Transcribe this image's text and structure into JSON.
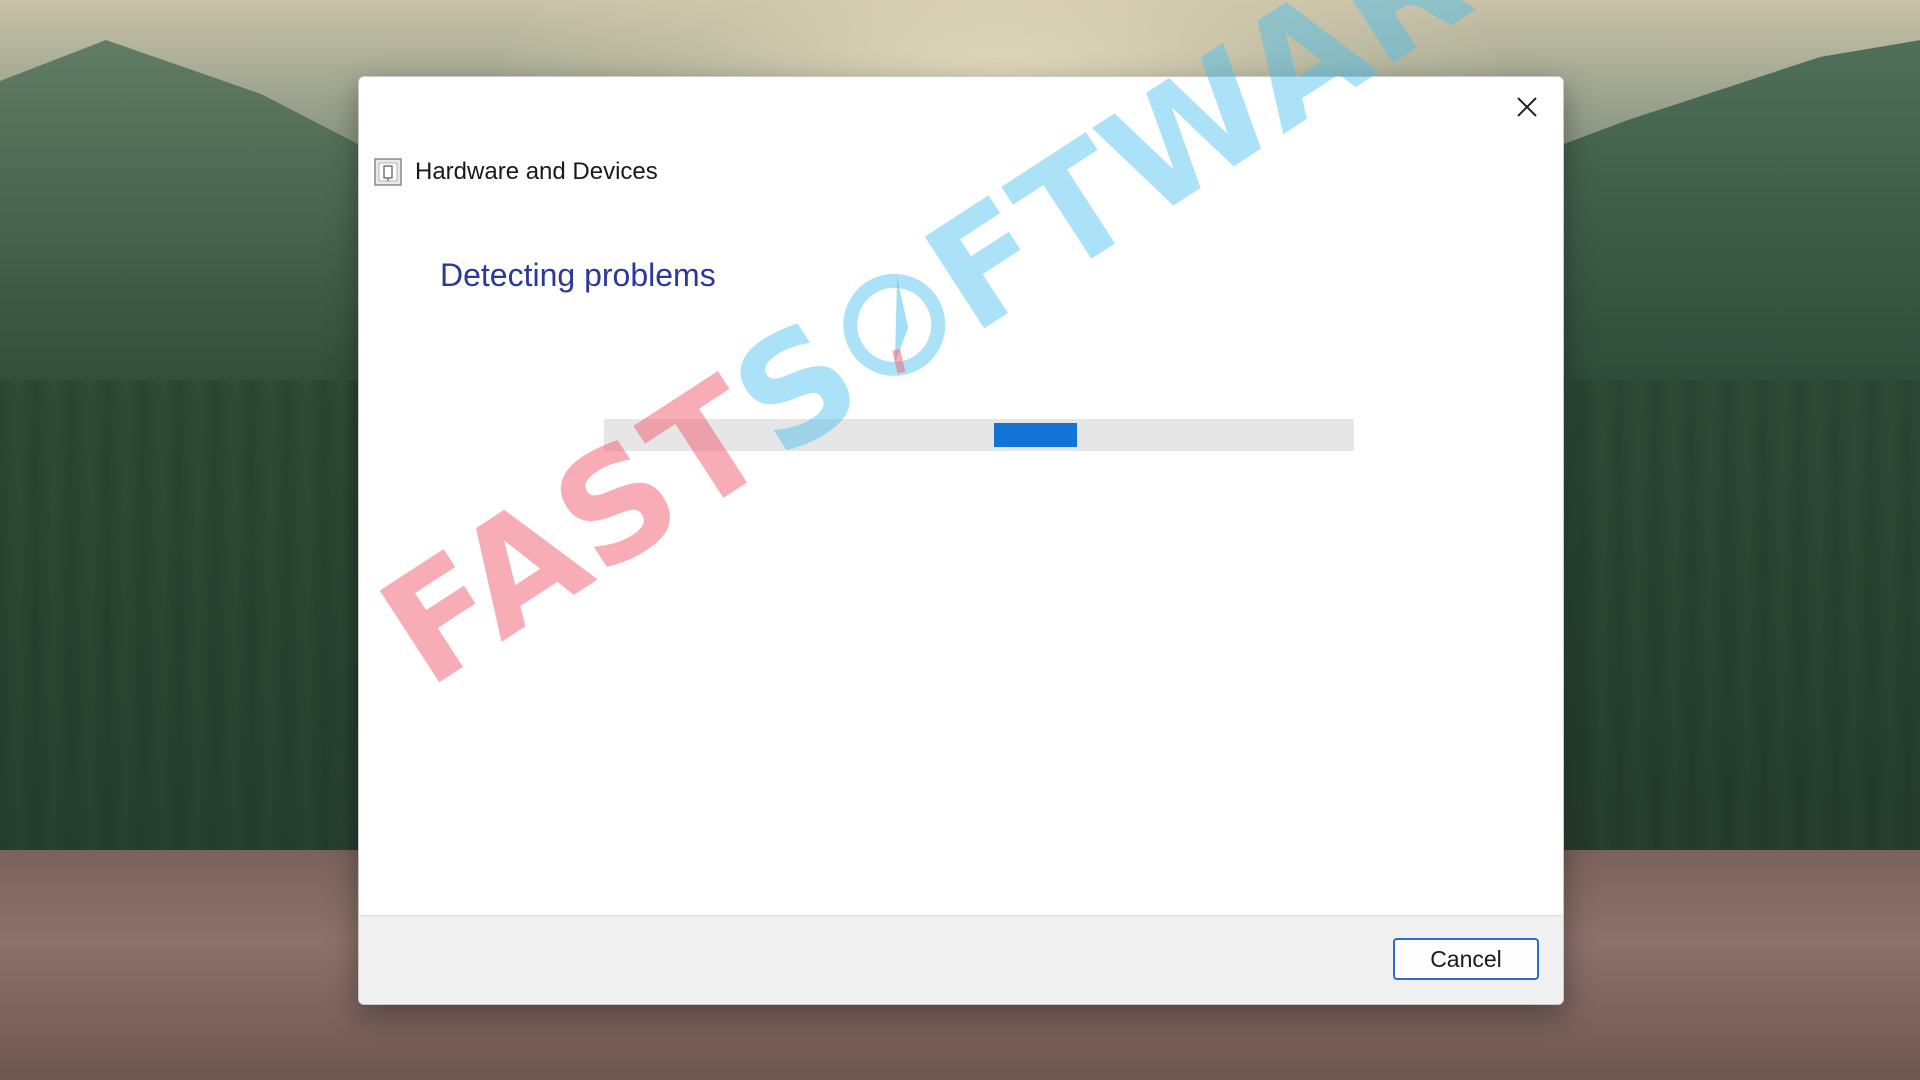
{
  "dialog": {
    "app_title": "Hardware and Devices",
    "heading": "Detecting problems",
    "progress": {
      "state": "indeterminate",
      "chunk_start_fraction": 0.52,
      "chunk_width_fraction": 0.11,
      "color": "#1474d6"
    },
    "buttons": {
      "cancel_label": "Cancel",
      "close_icon": "close-icon"
    },
    "icons": {
      "app_icon": "troubleshooter-icon"
    }
  },
  "watermark": {
    "part1": "FAST",
    "part2": "S",
    "part3": "FTWARES",
    "logo_icon": "rocket-circle-logo"
  },
  "colors": {
    "heading": "#2b3a9a",
    "accent": "#2a6fc9"
  }
}
